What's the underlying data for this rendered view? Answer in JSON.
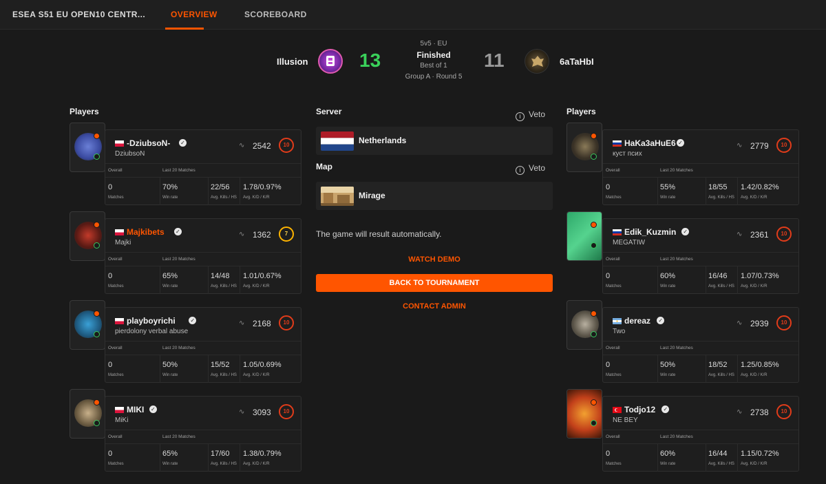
{
  "header": {
    "title": "ESEA S51 EU OPEN10 CENTR...",
    "tabs": [
      {
        "label": "OVERVIEW",
        "active": true
      },
      {
        "label": "SCOREBOARD",
        "active": false
      }
    ]
  },
  "match": {
    "team1": {
      "name": "Illusion",
      "score": "13"
    },
    "team2": {
      "name": "6aTaHbI",
      "score": "11"
    },
    "format": "5v5 · EU",
    "status": "Finished",
    "best_of": "Best of 1",
    "stage": "Group A · Round 5"
  },
  "labels": {
    "players": "Players",
    "server": "Server",
    "map": "Map",
    "veto": "Veto",
    "overall": "Overall",
    "last20": "Last 20 Matches",
    "matches": "Matches",
    "win_rate": "Win rate",
    "kills_hs": "Avg. Kills / HS",
    "kd_kr": "Avg. K/D / K/R"
  },
  "server": {
    "name": "Netherlands"
  },
  "map": {
    "name": "Mirage"
  },
  "info": {
    "auto_result": "The game will result automatically."
  },
  "actions": {
    "watch_demo": "WATCH DEMO",
    "back": "BACK TO TOURNAMENT",
    "contact": "CONTACT ADMIN"
  },
  "team1_players": [
    {
      "nick": "-DziubsoN-",
      "sub": "DziubsoN",
      "flag": "PL",
      "elo": "2542",
      "level": "10",
      "matches": "0",
      "winrate": "70%",
      "kills_hs": "22/56",
      "kd_kr": "1.78/0.97%"
    },
    {
      "nick": "Majkibets",
      "sub": "Majki",
      "flag": "PL",
      "elo": "1362",
      "level": "7",
      "matches": "0",
      "winrate": "65%",
      "kills_hs": "14/48",
      "kd_kr": "1.01/0.67%"
    },
    {
      "nick": "playboyrichi",
      "sub": "pierdolony verbal abuse",
      "flag": "PL",
      "elo": "2168",
      "level": "10",
      "matches": "0",
      "winrate": "50%",
      "kills_hs": "15/52",
      "kd_kr": "1.05/0.69%"
    },
    {
      "nick": "MIKI",
      "sub": "MiKi",
      "flag": "PL",
      "elo": "3093",
      "level": "10",
      "matches": "0",
      "winrate": "65%",
      "kills_hs": "17/60",
      "kd_kr": "1.38/0.79%"
    }
  ],
  "team2_players": [
    {
      "nick": "HaKa3aHuE6",
      "sub": "куст псих",
      "flag": "RU",
      "elo": "2779",
      "level": "10",
      "matches": "0",
      "winrate": "55%",
      "kills_hs": "18/55",
      "kd_kr": "1.42/0.82%"
    },
    {
      "nick": "Edik_Kuzmin",
      "sub": "MEGATIW",
      "flag": "RU",
      "elo": "2361",
      "level": "10",
      "matches": "0",
      "winrate": "60%",
      "kills_hs": "16/46",
      "kd_kr": "1.07/0.73%"
    },
    {
      "nick": "dereaz",
      "sub": "Two",
      "flag": "AR",
      "elo": "2939",
      "level": "10",
      "matches": "0",
      "winrate": "50%",
      "kills_hs": "18/52",
      "kd_kr": "1.25/0.85%"
    },
    {
      "nick": "Todjo12",
      "sub": "NE BEY",
      "flag": "TR",
      "elo": "2738",
      "level": "10",
      "matches": "0",
      "winrate": "60%",
      "kills_hs": "16/44",
      "kd_kr": "1.15/0.72%"
    }
  ]
}
